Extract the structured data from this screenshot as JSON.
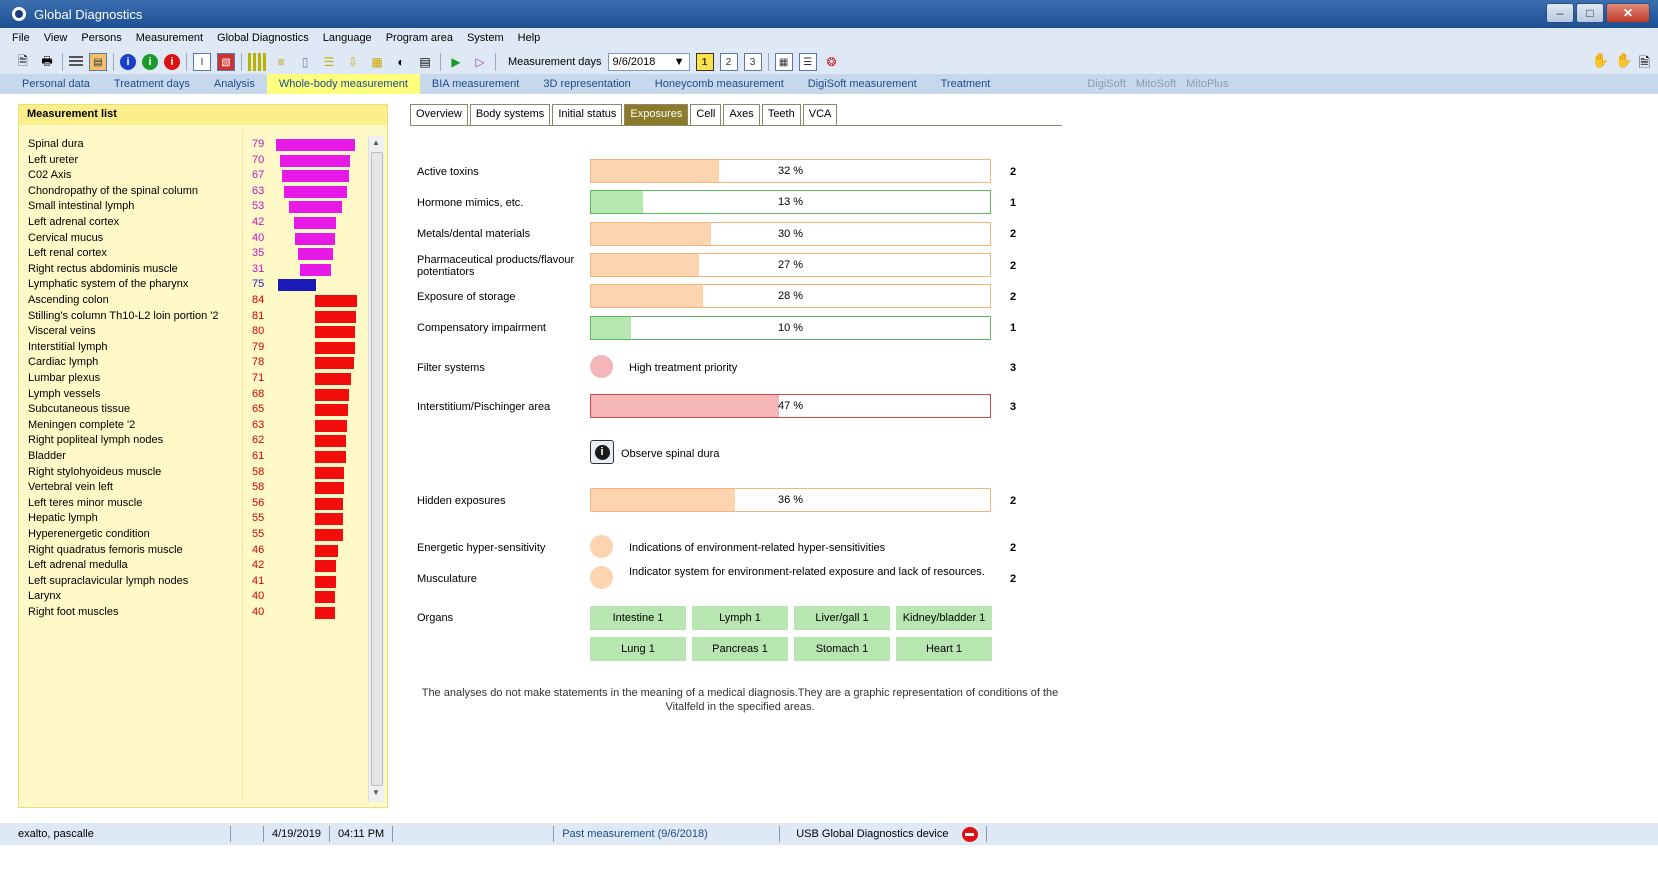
{
  "window": {
    "title": "Global Diagnostics"
  },
  "menu": [
    "File",
    "View",
    "Persons",
    "Measurement",
    "Global Diagnostics",
    "Language",
    "Program area",
    "System",
    "Help"
  ],
  "toolbar": {
    "measurement_days_label": "Measurement days",
    "date_value": "9/6/2018",
    "day_buttons": [
      "1",
      "2",
      "3"
    ],
    "active_day": "1"
  },
  "nav_tabs": [
    "Personal data",
    "Treatment days",
    "Analysis",
    "Whole-body measurement",
    "BIA measurement",
    "3D representation",
    "Honeycomb measurement",
    "DigiSoft measurement",
    "Treatment"
  ],
  "nav_active": "Whole-body measurement",
  "nav_extra": [
    "DigiSoft",
    "MitoSoft",
    "MitoPlus"
  ],
  "measurement_list": {
    "title": "Measurement list",
    "items": [
      {
        "label": "Spinal dura",
        "value": 79,
        "color": "#e619e6",
        "group": "magenta"
      },
      {
        "label": "Left ureter",
        "value": 70,
        "color": "#e619e6",
        "group": "magenta"
      },
      {
        "label": "C02 Axis",
        "value": 67,
        "color": "#e619e6",
        "group": "magenta"
      },
      {
        "label": "Chondropathy of the spinal column",
        "value": 63,
        "color": "#e619e6",
        "group": "magenta"
      },
      {
        "label": "Small intestinal lymph",
        "value": 53,
        "color": "#e619e6",
        "group": "magenta"
      },
      {
        "label": "Left adrenal cortex",
        "value": 42,
        "color": "#e619e6",
        "group": "magenta"
      },
      {
        "label": "Cervical mucus",
        "value": 40,
        "color": "#e619e6",
        "group": "magenta"
      },
      {
        "label": "Left renal cortex",
        "value": 35,
        "color": "#e619e6",
        "group": "magenta"
      },
      {
        "label": "Right rectus abdominis muscle",
        "value": 31,
        "color": "#e619e6",
        "group": "magenta"
      },
      {
        "label": "Lymphatic system of the pharynx",
        "value": 75,
        "color": "#1a1ab8",
        "group": "blue"
      },
      {
        "label": "Ascending colon",
        "value": 84,
        "color": "#f20d0d",
        "group": "red"
      },
      {
        "label": "Stilling's column Th10-L2 loin portion '2",
        "value": 81,
        "color": "#f20d0d",
        "group": "red"
      },
      {
        "label": "Visceral veins",
        "value": 80,
        "color": "#f20d0d",
        "group": "red"
      },
      {
        "label": "Interstitial lymph",
        "value": 79,
        "color": "#f20d0d",
        "group": "red"
      },
      {
        "label": "Cardiac lymph",
        "value": 78,
        "color": "#f20d0d",
        "group": "red"
      },
      {
        "label": "Lumbar plexus",
        "value": 71,
        "color": "#f20d0d",
        "group": "red"
      },
      {
        "label": "Lymph vessels",
        "value": 68,
        "color": "#f20d0d",
        "group": "red"
      },
      {
        "label": "Subcutaneous tissue",
        "value": 65,
        "color": "#f20d0d",
        "group": "red"
      },
      {
        "label": "Meningen complete '2",
        "value": 63,
        "color": "#f20d0d",
        "group": "red"
      },
      {
        "label": "Right popliteal lymph nodes",
        "value": 62,
        "color": "#f20d0d",
        "group": "red"
      },
      {
        "label": "Bladder",
        "value": 61,
        "color": "#f20d0d",
        "group": "red"
      },
      {
        "label": "Right stylohyoideus muscle",
        "value": 58,
        "color": "#f20d0d",
        "group": "red"
      },
      {
        "label": "Vertebral vein left",
        "value": 58,
        "color": "#f20d0d",
        "group": "red"
      },
      {
        "label": "Left teres minor muscle",
        "value": 56,
        "color": "#f20d0d",
        "group": "red"
      },
      {
        "label": "Hepatic lymph",
        "value": 55,
        "color": "#f20d0d",
        "group": "red"
      },
      {
        "label": "Hyperenergetic condition",
        "value": 55,
        "color": "#f20d0d",
        "group": "red"
      },
      {
        "label": "Right quadratus femoris muscle",
        "value": 46,
        "color": "#f20d0d",
        "group": "red"
      },
      {
        "label": "Left adrenal medulla",
        "value": 42,
        "color": "#f20d0d",
        "group": "red"
      },
      {
        "label": "Left supraclavicular lymph nodes",
        "value": 41,
        "color": "#f20d0d",
        "group": "red"
      },
      {
        "label": "Larynx",
        "value": 40,
        "color": "#f20d0d",
        "group": "red"
      },
      {
        "label": "Right foot muscles",
        "value": 40,
        "color": "#f20d0d",
        "group": "red"
      }
    ]
  },
  "sub_tabs": [
    "Overview",
    "Body systems",
    "Initial status",
    "Exposures",
    "Cell",
    "Axes",
    "Teeth",
    "VCA"
  ],
  "sub_active": "Exposures",
  "exposures": {
    "active_toxins": {
      "label": "Active toxins",
      "percent": 32,
      "percent_text": "32 %",
      "level": "2"
    },
    "hormone_mimics": {
      "label": "Hormone mimics, etc.",
      "percent": 13,
      "percent_text": "13 %",
      "level": "1"
    },
    "metals": {
      "label": "Metals/dental materials",
      "percent": 30,
      "percent_text": "30 %",
      "level": "2"
    },
    "pharma": {
      "label": "Pharmaceutical products/flavour potentiators",
      "percent": 27,
      "percent_text": "27 %",
      "level": "2"
    },
    "storage": {
      "label": "Exposure of storage",
      "percent": 28,
      "percent_text": "28 %",
      "level": "2"
    },
    "compensatory": {
      "label": "Compensatory impairment",
      "percent": 10,
      "percent_text": "10 %",
      "level": "1"
    },
    "filter": {
      "label": "Filter systems",
      "text": "High treatment priority",
      "level": "3"
    },
    "interstitium": {
      "label": "Interstitium/Pischinger area",
      "percent": 47,
      "percent_text": "47 %",
      "level": "3"
    },
    "observe": {
      "text": "Observe spinal dura"
    },
    "hidden": {
      "label": "Hidden exposures",
      "percent": 36,
      "percent_text": "36 %",
      "level": "2"
    },
    "energetic": {
      "label": "Energetic hyper-sensitivity",
      "text": "Indications of environment-related hyper-sensitivities",
      "level": "2"
    },
    "musculature": {
      "label": "Musculature",
      "text": "Indicator system for environment-related exposure and lack of resources.",
      "level": "2"
    },
    "organs_label": "Organs",
    "organs": [
      "Intestine 1",
      "Lymph 1",
      "Liver/gall 1",
      "Kidney/bladder 1",
      "Lung 1",
      "Pancreas 1",
      "Stomach 1",
      "Heart 1"
    ]
  },
  "colors": {
    "orange_fill": "#fcd5b0",
    "orange_border": "#f0b77e",
    "green_fill": "#b8e6b0",
    "green_border": "#5db85d",
    "red_fill": "#f4b6b6",
    "red_border": "#d44a4a",
    "dot_red": "#f4b6b6",
    "dot_orange": "#fcd5b0"
  },
  "disclaimer": "The analyses do not make statements in the meaning of a medical diagnosis.They are a graphic representation of conditions of the Vitalfeld in the specified areas.",
  "status": {
    "user": "exalto, pascalle",
    "date": "4/19/2019",
    "time": "04:11 PM",
    "past": "Past measurement (9/6/2018)",
    "device": "USB Global Diagnostics device"
  }
}
